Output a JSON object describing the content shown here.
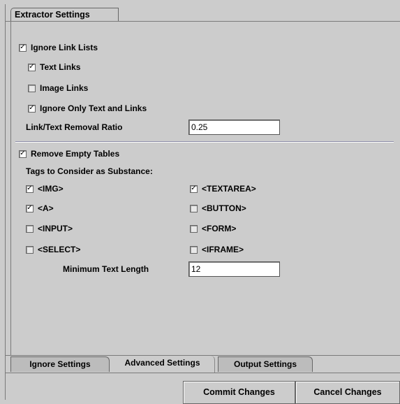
{
  "panel": {
    "title": "Extractor Settings"
  },
  "link_section": {
    "ignore_link_lists": {
      "label": "Ignore Link Lists",
      "checked": true
    },
    "text_links": {
      "label": "Text Links",
      "checked": true
    },
    "image_links": {
      "label": "Image Links",
      "checked": false
    },
    "ignore_only_text_links": {
      "label": "Ignore Only Text and Links",
      "checked": true
    },
    "ratio_label": "Link/Text Removal Ratio",
    "ratio_value": "0.25"
  },
  "table_section": {
    "remove_empty_tables": {
      "label": "Remove Empty Tables",
      "checked": true
    },
    "substance_label": "Tags to Consider as Substance:",
    "tags": [
      {
        "label": "<IMG>",
        "checked": true
      },
      {
        "label": "<TEXTAREA>",
        "checked": true
      },
      {
        "label": "<A>",
        "checked": true
      },
      {
        "label": "<BUTTON>",
        "checked": false
      },
      {
        "label": "<INPUT>",
        "checked": false
      },
      {
        "label": "<FORM>",
        "checked": false
      },
      {
        "label": "<SELECT>",
        "checked": false
      },
      {
        "label": "<IFRAME>",
        "checked": false
      }
    ],
    "min_text_label": "Minimum Text Length",
    "min_text_value": "12"
  },
  "tabs": [
    {
      "label": "Ignore Settings",
      "active": false
    },
    {
      "label": "Advanced Settings",
      "active": true
    },
    {
      "label": "Output Settings",
      "active": false
    }
  ],
  "buttons": {
    "commit": "Commit Changes",
    "cancel": "Cancel Changes"
  },
  "icons": {
    "check": "checkmark-icon"
  }
}
